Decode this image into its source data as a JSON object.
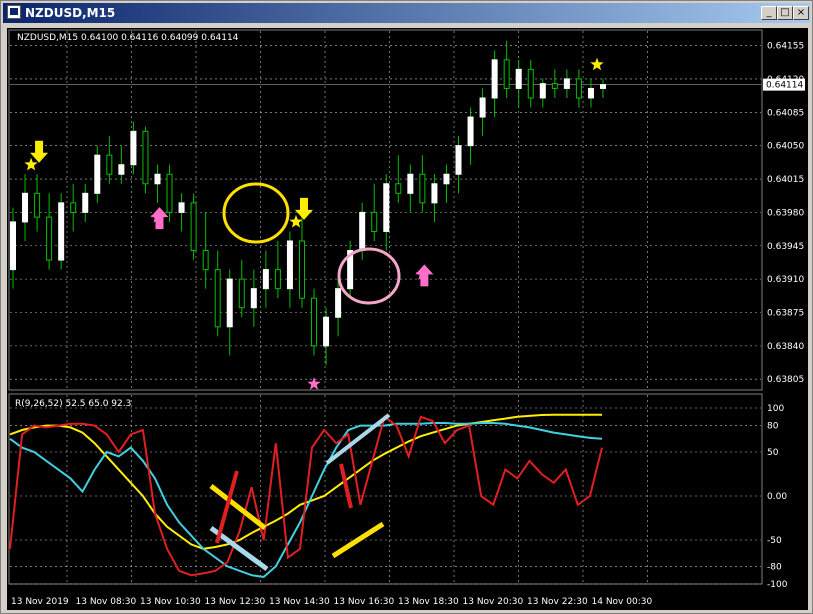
{
  "window": {
    "title": "NZDUSD,M15",
    "minimize_glyph": "_",
    "maximize_glyph": "□",
    "close_glyph": "×"
  },
  "main_panel": {
    "header": "NZDUSD,M15  0.64100 0.64116 0.64099 0.64114",
    "current_price": "0.64114",
    "price_ticks": [
      "0.64155",
      "0.64120",
      "0.64085",
      "0.64050",
      "0.64015",
      "0.63980",
      "0.63945",
      "0.63910",
      "0.63875",
      "0.63840",
      "0.63805"
    ]
  },
  "indicator_panel": {
    "header": "R(9,26,52) 52.5 65.0 92.3",
    "level_ticks": [
      "100",
      "80",
      "50",
      "0.00",
      "-50",
      "-80",
      "-100"
    ]
  },
  "time_axis": {
    "labels": [
      "13 Nov 2019",
      "13 Nov 08:30",
      "13 Nov 10:30",
      "13 Nov 12:30",
      "13 Nov 14:30",
      "13 Nov 16:30",
      "13 Nov 18:30",
      "13 Nov 20:30",
      "13 Nov 22:30",
      "14 Nov 00:30"
    ]
  },
  "colors": {
    "background": "#000000",
    "grid": "#c0c0c0",
    "bull_candle": "#ffffff",
    "wick": "#00c000",
    "star_yellow": "#ffee00",
    "star_pink": "#ff6ec7",
    "line_red": "#e02020",
    "line_cyan": "#40d0e0",
    "line_yellow": "#ffee00",
    "annot_blue": "#a8d8ea",
    "annot_yellow": "#ffe000",
    "annot_red": "#e02020"
  },
  "chart_data": {
    "type": "candlestick",
    "symbol": "NZDUSD",
    "timeframe": "M15",
    "ohlc_last": {
      "open": 0.641,
      "high": 0.64116,
      "low": 0.64099,
      "close": 0.64114
    },
    "ylim": [
      0.638,
      0.6417
    ],
    "candles": [
      [
        0.6392,
        0.63985,
        0.639,
        0.6397
      ],
      [
        0.6397,
        0.6402,
        0.6395,
        0.64
      ],
      [
        0.64,
        0.6402,
        0.6396,
        0.63975
      ],
      [
        0.63975,
        0.64,
        0.6392,
        0.6393
      ],
      [
        0.6393,
        0.64,
        0.6392,
        0.6399
      ],
      [
        0.6399,
        0.6401,
        0.6396,
        0.6398
      ],
      [
        0.6398,
        0.6401,
        0.6397,
        0.64
      ],
      [
        0.64,
        0.6405,
        0.6399,
        0.6404
      ],
      [
        0.6404,
        0.6406,
        0.6401,
        0.6402
      ],
      [
        0.6402,
        0.6405,
        0.6401,
        0.6403
      ],
      [
        0.6403,
        0.64075,
        0.6402,
        0.64065
      ],
      [
        0.64065,
        0.6407,
        0.64,
        0.6401
      ],
      [
        0.6401,
        0.6403,
        0.6399,
        0.6402
      ],
      [
        0.6402,
        0.6403,
        0.6397,
        0.6398
      ],
      [
        0.6398,
        0.64,
        0.6396,
        0.6399
      ],
      [
        0.6399,
        0.64,
        0.6393,
        0.6394
      ],
      [
        0.6394,
        0.6398,
        0.639,
        0.6392
      ],
      [
        0.6392,
        0.6394,
        0.6385,
        0.6386
      ],
      [
        0.6386,
        0.6392,
        0.6383,
        0.6391
      ],
      [
        0.6391,
        0.6393,
        0.6387,
        0.6388
      ],
      [
        0.6388,
        0.6392,
        0.6386,
        0.639
      ],
      [
        0.639,
        0.6394,
        0.6388,
        0.6392
      ],
      [
        0.6392,
        0.6395,
        0.6389,
        0.639
      ],
      [
        0.639,
        0.6396,
        0.6388,
        0.6395
      ],
      [
        0.6395,
        0.6398,
        0.6388,
        0.6389
      ],
      [
        0.6389,
        0.639,
        0.6383,
        0.6384
      ],
      [
        0.6384,
        0.6388,
        0.6382,
        0.6387
      ],
      [
        0.6387,
        0.6391,
        0.6385,
        0.639
      ],
      [
        0.639,
        0.6395,
        0.6389,
        0.6394
      ],
      [
        0.6394,
        0.6399,
        0.6393,
        0.6398
      ],
      [
        0.6398,
        0.6401,
        0.6395,
        0.6396
      ],
      [
        0.6396,
        0.6402,
        0.6394,
        0.6401
      ],
      [
        0.6401,
        0.6404,
        0.6399,
        0.64
      ],
      [
        0.64,
        0.6403,
        0.6398,
        0.6402
      ],
      [
        0.6402,
        0.6404,
        0.6398,
        0.6399
      ],
      [
        0.6399,
        0.6402,
        0.6397,
        0.6401
      ],
      [
        0.6401,
        0.6403,
        0.6399,
        0.6402
      ],
      [
        0.6402,
        0.6406,
        0.64,
        0.6405
      ],
      [
        0.6405,
        0.6409,
        0.6403,
        0.6408
      ],
      [
        0.6408,
        0.6411,
        0.6406,
        0.641
      ],
      [
        0.641,
        0.6415,
        0.6408,
        0.6414
      ],
      [
        0.6414,
        0.6416,
        0.641,
        0.6411
      ],
      [
        0.6411,
        0.6414,
        0.6409,
        0.6413
      ],
      [
        0.6413,
        0.6414,
        0.6409,
        0.641
      ],
      [
        0.641,
        0.6412,
        0.6409,
        0.64115
      ],
      [
        0.64115,
        0.6413,
        0.641,
        0.6411
      ],
      [
        0.6411,
        0.6413,
        0.641,
        0.6412
      ],
      [
        0.6412,
        0.6413,
        0.6409,
        0.641
      ],
      [
        0.641,
        0.6412,
        0.6409,
        0.6411
      ],
      [
        0.6411,
        0.6412,
        0.641,
        0.64114
      ]
    ],
    "signals": [
      {
        "type": "sell",
        "price": 0.6403,
        "index": 2
      },
      {
        "type": "buy",
        "price": 0.63975,
        "index": 12
      },
      {
        "type": "sell",
        "price": 0.6397,
        "index": 24
      },
      {
        "type": "buy",
        "price": 0.638,
        "index": 25
      },
      {
        "type": "buy",
        "price": 0.63915,
        "index": 34
      },
      {
        "type": "sell",
        "price": 0.64135,
        "index": 49
      }
    ],
    "indicator": {
      "name": "R(9,26,52)",
      "ylim": [
        -100,
        100
      ],
      "values_last": [
        52.5,
        65.0,
        92.3
      ],
      "red": [
        -60,
        70,
        80,
        78,
        80,
        82,
        82,
        80,
        70,
        50,
        70,
        75,
        -20,
        -60,
        -85,
        -90,
        -88,
        -85,
        -75,
        -40,
        10,
        -50,
        60,
        -70,
        -60,
        55,
        75,
        60,
        70,
        -10,
        40,
        90,
        80,
        45,
        90,
        85,
        60,
        75,
        80,
        0,
        -10,
        30,
        20,
        40,
        25,
        15,
        30,
        -10,
        0,
        55
      ],
      "cyan": [
        65,
        55,
        50,
        40,
        30,
        20,
        5,
        30,
        50,
        45,
        55,
        40,
        20,
        -10,
        -30,
        -45,
        -60,
        -70,
        -80,
        -85,
        -90,
        -92,
        -80,
        -55,
        -30,
        0,
        30,
        55,
        75,
        80,
        80,
        80,
        82,
        82,
        82,
        83,
        83,
        82,
        82,
        83,
        83,
        82,
        80,
        78,
        75,
        72,
        70,
        68,
        66,
        65
      ],
      "yellow": [
        70,
        75,
        78,
        80,
        80,
        78,
        72,
        60,
        45,
        30,
        15,
        0,
        -20,
        -35,
        -45,
        -55,
        -60,
        -58,
        -55,
        -50,
        -42,
        -35,
        -28,
        -20,
        -10,
        -5,
        0,
        10,
        20,
        30,
        40,
        48,
        55,
        62,
        68,
        72,
        76,
        80,
        82,
        84,
        86,
        88,
        90,
        91,
        92,
        92.3,
        92.3,
        92.3,
        92.3,
        92.3
      ]
    }
  }
}
